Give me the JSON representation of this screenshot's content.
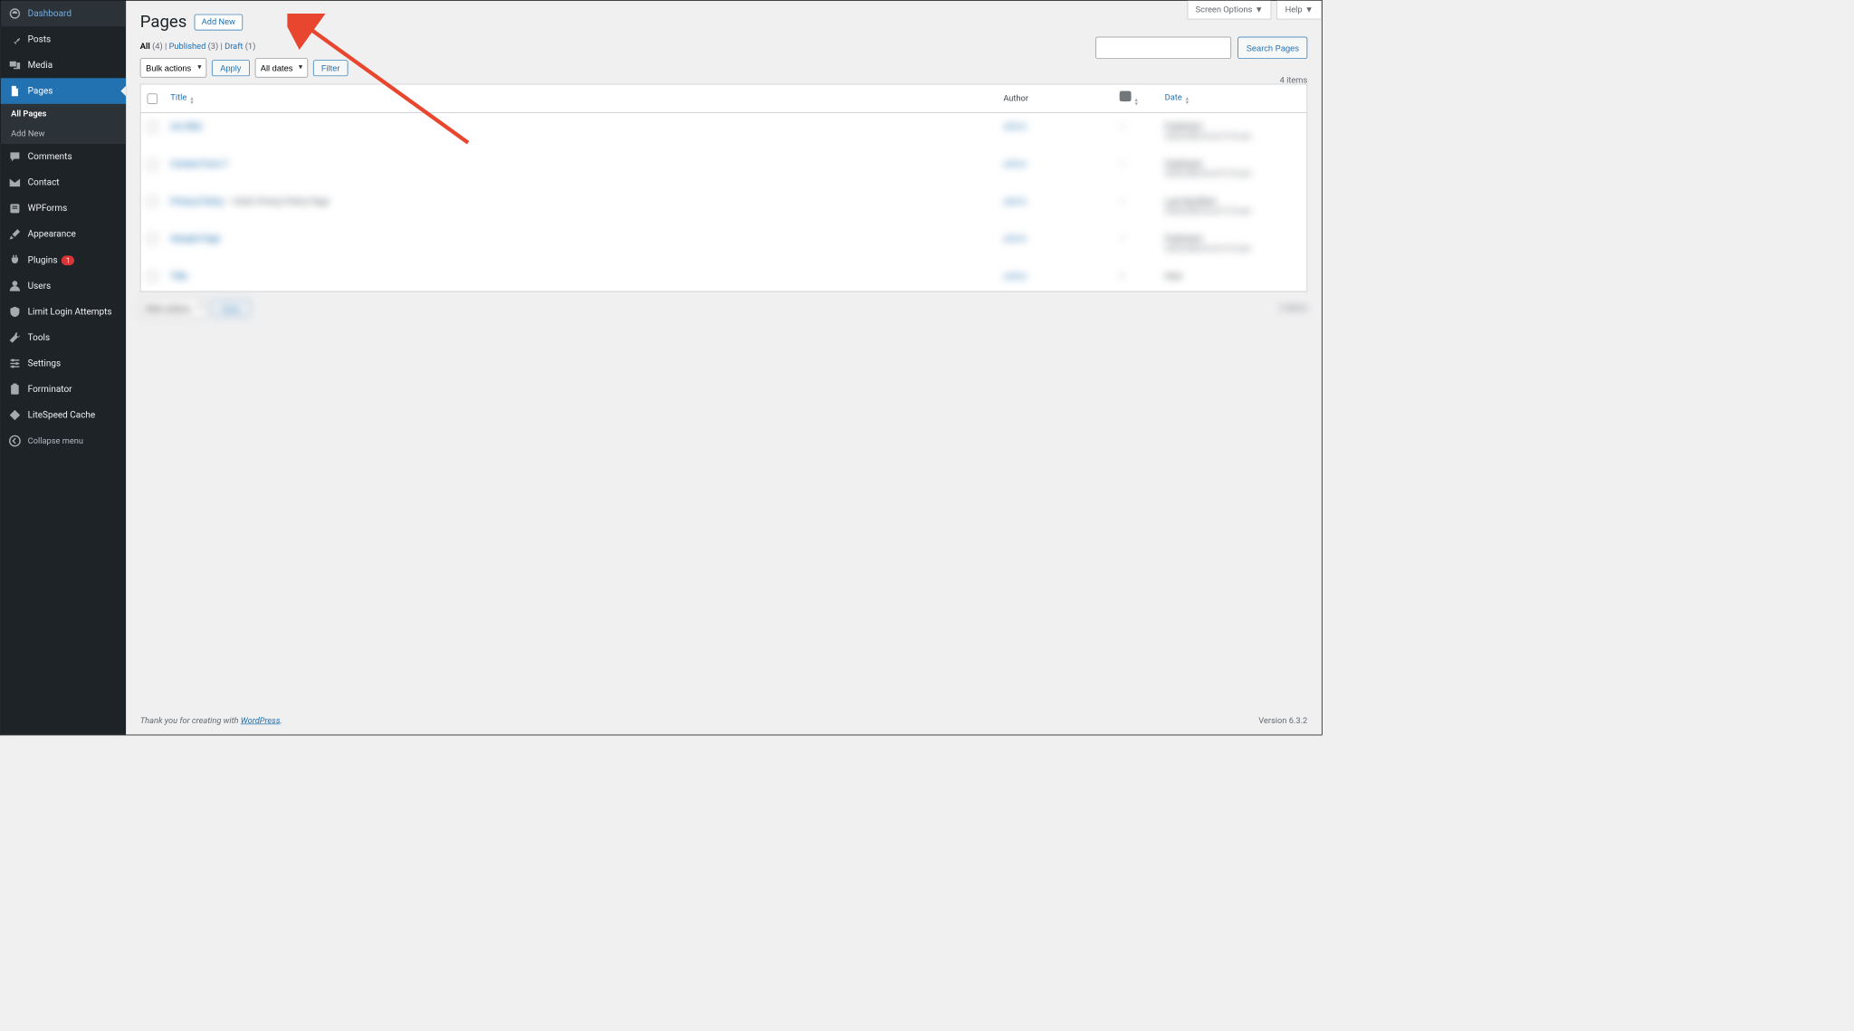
{
  "top": {
    "screen_options": "Screen Options",
    "help": "Help"
  },
  "sidebar": {
    "items": [
      {
        "label": "Dashboard"
      },
      {
        "label": "Posts"
      },
      {
        "label": "Media"
      },
      {
        "label": "Pages"
      },
      {
        "label": "Comments"
      },
      {
        "label": "Contact"
      },
      {
        "label": "WPForms"
      },
      {
        "label": "Appearance"
      },
      {
        "label": "Plugins"
      },
      {
        "label": "Users"
      },
      {
        "label": "Limit Login Attempts"
      },
      {
        "label": "Tools"
      },
      {
        "label": "Settings"
      },
      {
        "label": "Forminator"
      },
      {
        "label": "LiteSpeed Cache"
      }
    ],
    "plugins_badge": "1",
    "submenu": {
      "all_pages": "All Pages",
      "add_new": "Add New"
    },
    "collapse": "Collapse menu"
  },
  "page": {
    "title": "Pages",
    "add_new": "Add New"
  },
  "filters": {
    "all_label": "All",
    "all_count": "(4)",
    "published_label": "Published",
    "published_count": "(3)",
    "draft_label": "Draft",
    "draft_count": "(1)",
    "sep": " | "
  },
  "actions": {
    "bulk": "Bulk actions",
    "apply": "Apply",
    "dates": "All dates",
    "filter": "Filter",
    "search": "Search Pages"
  },
  "summary": {
    "items": "4 items"
  },
  "table": {
    "col_title": "Title",
    "col_author": "Author",
    "col_date": "Date",
    "rows": [
      {
        "title": "(no title)",
        "author": "admin",
        "comments": "—",
        "date_status": "Published",
        "date_value": "2023/08/24 at 9:15 am"
      },
      {
        "title": "Contact Form 7",
        "author": "admin",
        "comments": "—",
        "date_status": "Published",
        "date_value": "2023/08/24 at 9:15 am"
      },
      {
        "title": "Privacy Policy",
        "title_suffix": "— Draft, Privacy Policy Page",
        "author": "admin",
        "comments": "—",
        "date_status": "Last Modified",
        "date_value": "2023/08/24 at 9:15 am"
      },
      {
        "title": "Sample Page",
        "author": "admin",
        "comments": "—",
        "date_status": "Published",
        "date_value": "2023/08/24 at 9:15 am"
      },
      {
        "title": "Title",
        "author": "author",
        "comments": "1",
        "date_status": "Date",
        "date_value": ""
      }
    ]
  },
  "footer": {
    "thanks_pre": "Thank you for creating with ",
    "thanks_link": "WordPress",
    "thanks_post": ".",
    "version": "Version 6.3.2"
  }
}
